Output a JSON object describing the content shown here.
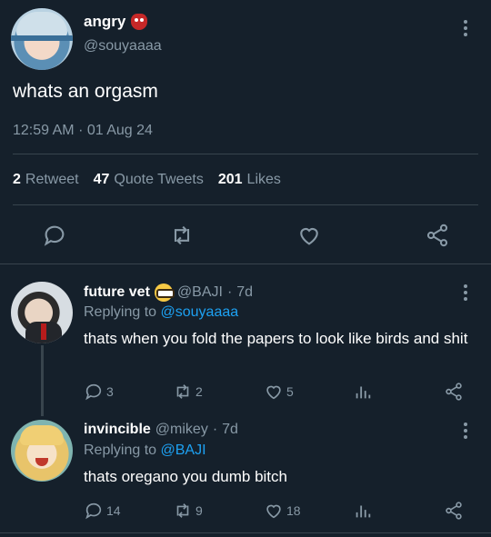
{
  "main_tweet": {
    "name": "angry",
    "handle": "@souyaaaa",
    "text": "whats an orgasm",
    "time": "12:59 AM",
    "date": "01 Aug 24",
    "separator": "·",
    "stats": {
      "retweets_count": "2",
      "retweets_label": "Retweet",
      "quotes_count": "47",
      "quotes_label": "Quote Tweets",
      "likes_count": "201",
      "likes_label": "Likes"
    }
  },
  "replies": [
    {
      "name": "future vet",
      "handle": "@BAJI",
      "age": "7d",
      "replying_prefix": "Replying to",
      "replying_to": "@souyaaaa",
      "text": "thats when you fold the papers to look like birds and shit",
      "replies": "3",
      "retweets": "2",
      "likes": "5"
    },
    {
      "name": "invincible",
      "handle": "@mikey",
      "age": "7d",
      "replying_prefix": "Replying to",
      "replying_to": "@BAJI",
      "text": "thats oregano you dumb bitch",
      "replies": "14",
      "retweets": "9",
      "likes": "18"
    }
  ],
  "icons": [
    "reply-icon",
    "retweet-icon",
    "like-icon",
    "share-icon",
    "analytics-icon",
    "more-icon"
  ],
  "colors": {
    "background": "#15202b",
    "text": "#ffffff",
    "muted": "#8899a6",
    "link": "#1da1f2",
    "divider": "#38444d"
  }
}
